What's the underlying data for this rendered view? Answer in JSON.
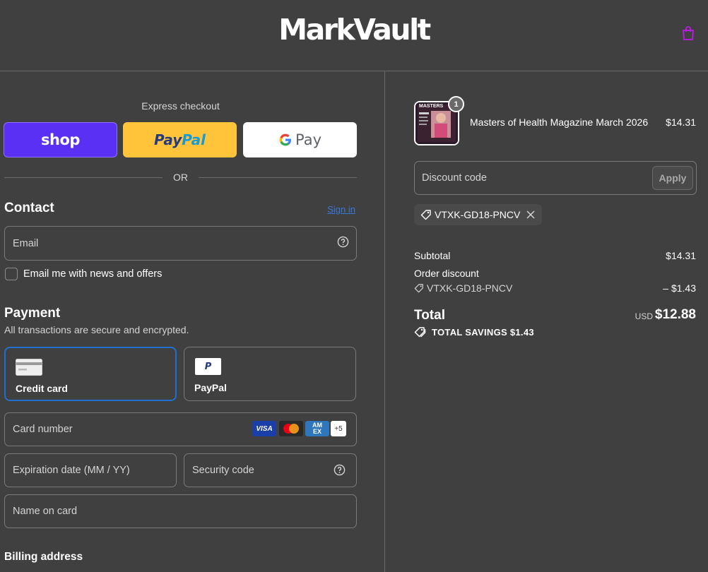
{
  "header": {
    "logo": "MarkVault",
    "cart_icon": "shopping-bag-icon",
    "cart_icon_color": "#b21fd6"
  },
  "express": {
    "label": "Express checkout",
    "shop_label": "shop",
    "paypal_label_a": "Pay",
    "paypal_label_b": "Pal",
    "gpay_g": "G",
    "gpay_label": "Pay",
    "or": "OR"
  },
  "contact": {
    "title": "Contact",
    "signin": "Sign in",
    "email_placeholder": "Email",
    "newsletter_label": "Email me with news and offers"
  },
  "payment": {
    "title": "Payment",
    "subtitle": "All transactions are secure and encrypted.",
    "options": [
      {
        "label": "Credit card",
        "selected": true
      },
      {
        "label": "PayPal",
        "selected": false
      }
    ],
    "paypal_icon_text": "P",
    "card_number_placeholder": "Card number",
    "brands": {
      "visa": "VISA",
      "amex_a": "AM",
      "amex_b": "EX",
      "more": "+5"
    },
    "expiration_placeholder": "Expiration date (MM / YY)",
    "security_placeholder": "Security code",
    "name_placeholder": "Name on card"
  },
  "billing": {
    "title": "Billing address"
  },
  "order": {
    "item": {
      "name": "Masters of Health Magazine March 2026",
      "price": "$14.31",
      "quantity": "1",
      "thumb_title": "MASTERS"
    },
    "discount_placeholder": "Discount code",
    "apply_label": "Apply",
    "applied_code": "VTXK-GD18-PNCV",
    "subtotal_label": "Subtotal",
    "subtotal_value": "$14.31",
    "order_discount_label": "Order discount",
    "order_discount_code": "VTXK-GD18-PNCV",
    "order_discount_value": "– $1.43",
    "total_label": "Total",
    "total_currency": "USD",
    "total_value": "$12.88",
    "savings": "TOTAL SAVINGS $1.43"
  },
  "colors": {
    "background": "#404040",
    "accent": "#1f6fcf",
    "shop_purple": "#5a31f4",
    "paypal_yellow": "#ffc439"
  }
}
